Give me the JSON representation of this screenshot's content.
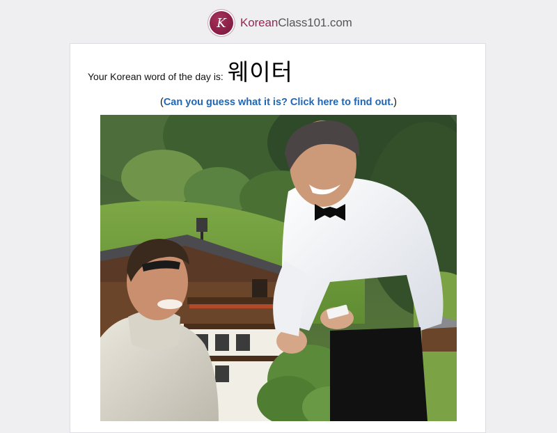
{
  "logo": {
    "brand_korean": "Korean",
    "brand_class": "Class101.com",
    "mark_text": "K"
  },
  "word_of_day": {
    "label": "Your Korean word of the day is:",
    "word": "웨이터"
  },
  "hint": {
    "open_paren": "(",
    "link_text": "Can you guess what it is? Click here to find out.",
    "close_paren": ")"
  },
  "photo": {
    "icon": "waiter-serving-customer-image"
  },
  "colors": {
    "brand": "#9a2554",
    "link": "#1e66b6",
    "page_bg": "#efeff2"
  }
}
